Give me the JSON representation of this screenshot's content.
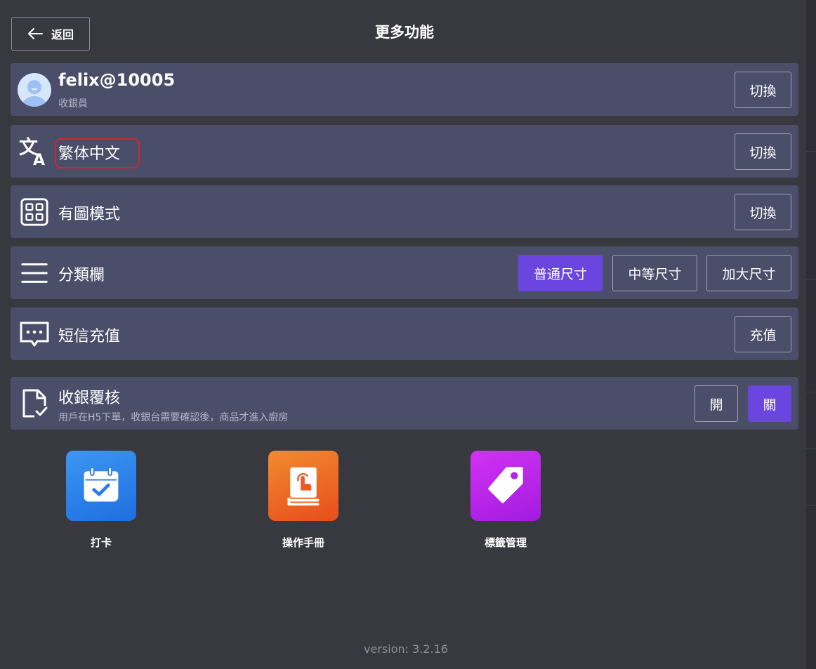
{
  "header": {
    "back_label": "返回",
    "title": "更多功能"
  },
  "user": {
    "name": "felix@10005",
    "role": "收銀員",
    "switch_label": "切換"
  },
  "language": {
    "label": "繁体中文",
    "switch_label": "切換",
    "icon": "translate-icon"
  },
  "view_mode": {
    "label": "有圖模式",
    "switch_label": "切換",
    "icon": "grid-icon"
  },
  "category_bar": {
    "label": "分類欄",
    "icon": "menu-icon",
    "options": [
      "普通尺寸",
      "中等尺寸",
      "加大尺寸"
    ],
    "selected": "普通尺寸"
  },
  "sms": {
    "label": "短信充值",
    "button_label": "充值",
    "icon": "message-icon"
  },
  "checkout_review": {
    "label": "收銀覆核",
    "description": "用戶在H5下單，收銀台需要確認後，商品才進入廚房",
    "on_label": "開",
    "off_label": "關",
    "selected": "關",
    "icon": "document-check-icon"
  },
  "apps": [
    {
      "label": "打卡",
      "icon": "calendar-check-icon",
      "color": "#2a7de9"
    },
    {
      "label": "操作手冊",
      "icon": "manual-book-icon",
      "color": "#ee5a24"
    },
    {
      "label": "標籤管理",
      "icon": "tag-icon",
      "color": "#b423e8"
    }
  ],
  "version": "version: 3.2.16",
  "colors": {
    "background": "#38383f",
    "row": "#4a4e68",
    "accent": "#6a45e0"
  }
}
